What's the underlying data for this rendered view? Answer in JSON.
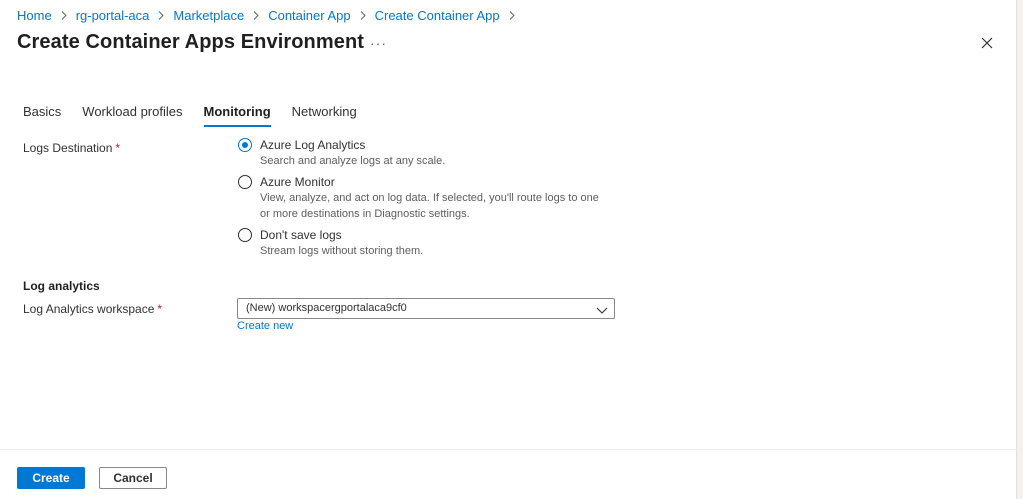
{
  "breadcrumb": [
    "Home",
    "rg-portal-aca",
    "Marketplace",
    "Container App",
    "Create Container App"
  ],
  "page": {
    "title": "Create Container Apps Environment",
    "more": "···"
  },
  "tabs": [
    {
      "label": "Basics",
      "active": false
    },
    {
      "label": "Workload profiles",
      "active": false
    },
    {
      "label": "Monitoring",
      "active": true
    },
    {
      "label": "Networking",
      "active": false
    }
  ],
  "logs_destination": {
    "label": "Logs Destination",
    "required_mark": "*",
    "options": [
      {
        "title": "Azure Log Analytics",
        "desc": "Search and analyze logs at any scale.",
        "checked": true
      },
      {
        "title": "Azure Monitor",
        "desc": "View, analyze, and act on log data. If selected, you'll route logs to one or more destinations in Diagnostic settings.",
        "checked": false
      },
      {
        "title": "Don't save logs",
        "desc": "Stream logs without storing them.",
        "checked": false
      }
    ]
  },
  "log_analytics": {
    "section_title": "Log analytics",
    "workspace_label": "Log Analytics workspace",
    "required_mark": "*",
    "workspace_value": "(New) workspacergportalaca9cf0",
    "create_new": "Create new"
  },
  "footer": {
    "create": "Create",
    "cancel": "Cancel"
  },
  "colors": {
    "accent": "#0078d4",
    "required": "#a4262c",
    "text": "#323130"
  },
  "icons": {
    "close": "close-icon",
    "chevron": "chevron-down-icon",
    "separator": "chevron-right-icon"
  }
}
